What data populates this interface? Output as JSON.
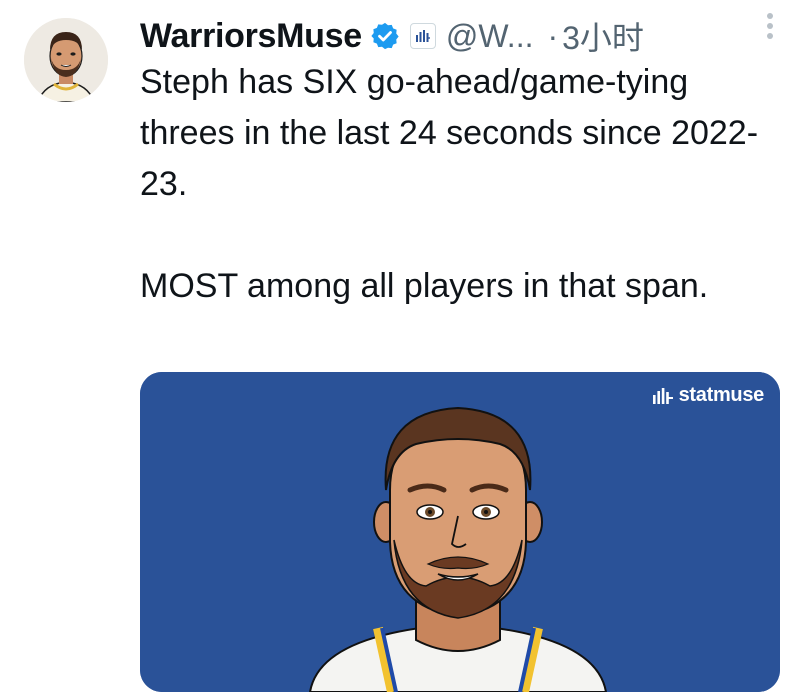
{
  "author": {
    "display_name": "WarriorsMuse",
    "handle": "@W...",
    "separator": "·",
    "timestamp": "3小时",
    "verified_icon": "verified-badge-icon",
    "affiliation_icon": "statmuse-affiliate-icon"
  },
  "tweet": {
    "paragraph_1": "Steph has SIX go-ahead/game-tying threes in the last 24 seconds since 2022-23.",
    "paragraph_2": "MOST among all players in that span."
  },
  "media": {
    "brand_label": "statmuse",
    "background_color": "#2a5298"
  },
  "colors": {
    "verified_blue": "#1d9bf0",
    "text_primary": "#0f1419",
    "text_secondary": "#536471"
  }
}
